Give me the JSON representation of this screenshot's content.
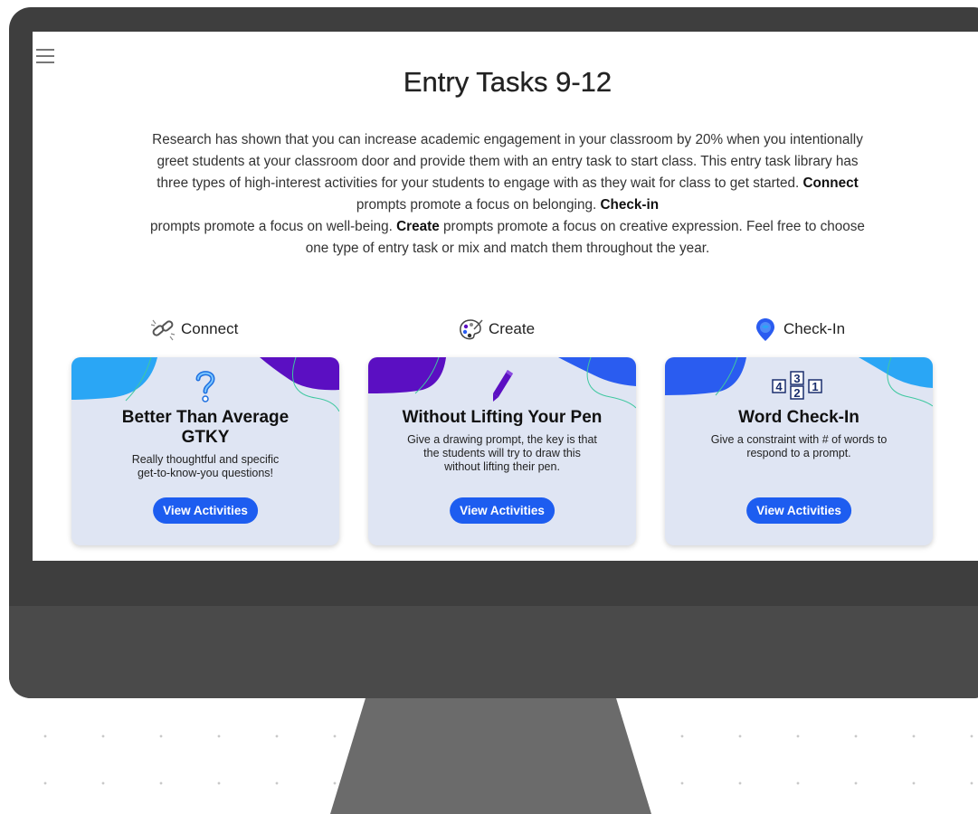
{
  "page": {
    "title": "Entry Tasks 9-12",
    "intro": {
      "p1": "Research has shown that you can increase academic engagement in your classroom by 20% when you intentionally greet students at your classroom door and provide them with an entry task to start class. This entry task library has three types of high-interest activities for your students to engage with as they wait for class to get started. ",
      "connect": "Connect",
      "p2": " prompts promote a focus on belonging. ",
      "checkin": "Check-in",
      "p3": " prompts promote a focus on well-being. ",
      "create": "Create",
      "p4": " prompts promote a focus on creative expression. Feel free to choose one type of entry task or mix and match them throughout the year."
    }
  },
  "categories": [
    {
      "label": "Connect",
      "icon": "link-icon"
    },
    {
      "label": "Create",
      "icon": "palette-icon"
    },
    {
      "label": "Check-In",
      "icon": "map-pin-icon"
    }
  ],
  "cards": [
    {
      "icon": "question-mark-icon",
      "title_line1": "Better Than Average",
      "title_line2": "GTKY",
      "desc_line1": "Really thoughtful and specific",
      "desc_line2": "get-to-know-you questions!",
      "button": "View Activities"
    },
    {
      "icon": "pen-icon",
      "title_line1": "Without Lifting Your Pen",
      "desc_line1": "Give a drawing prompt, the key is that",
      "desc_line2": "the students will try to draw this",
      "desc_line3": "without lifting their pen.",
      "button": "View Activities"
    },
    {
      "icon": "number-blocks-icon",
      "title_line1": "Word Check-In",
      "desc_line1": "Give a constraint with # of words to",
      "desc_line2": "respond to a prompt.",
      "button": "View Activities",
      "blocks": [
        "4",
        "3",
        "2",
        "1"
      ]
    }
  ],
  "colors": {
    "accent": "#1d5df0",
    "card_bg": "#dfe5f3",
    "deco_blue": "#2aa6f5",
    "deco_purple": "#5b0fc2",
    "deco_dark_blue": "#2a5cf0"
  }
}
